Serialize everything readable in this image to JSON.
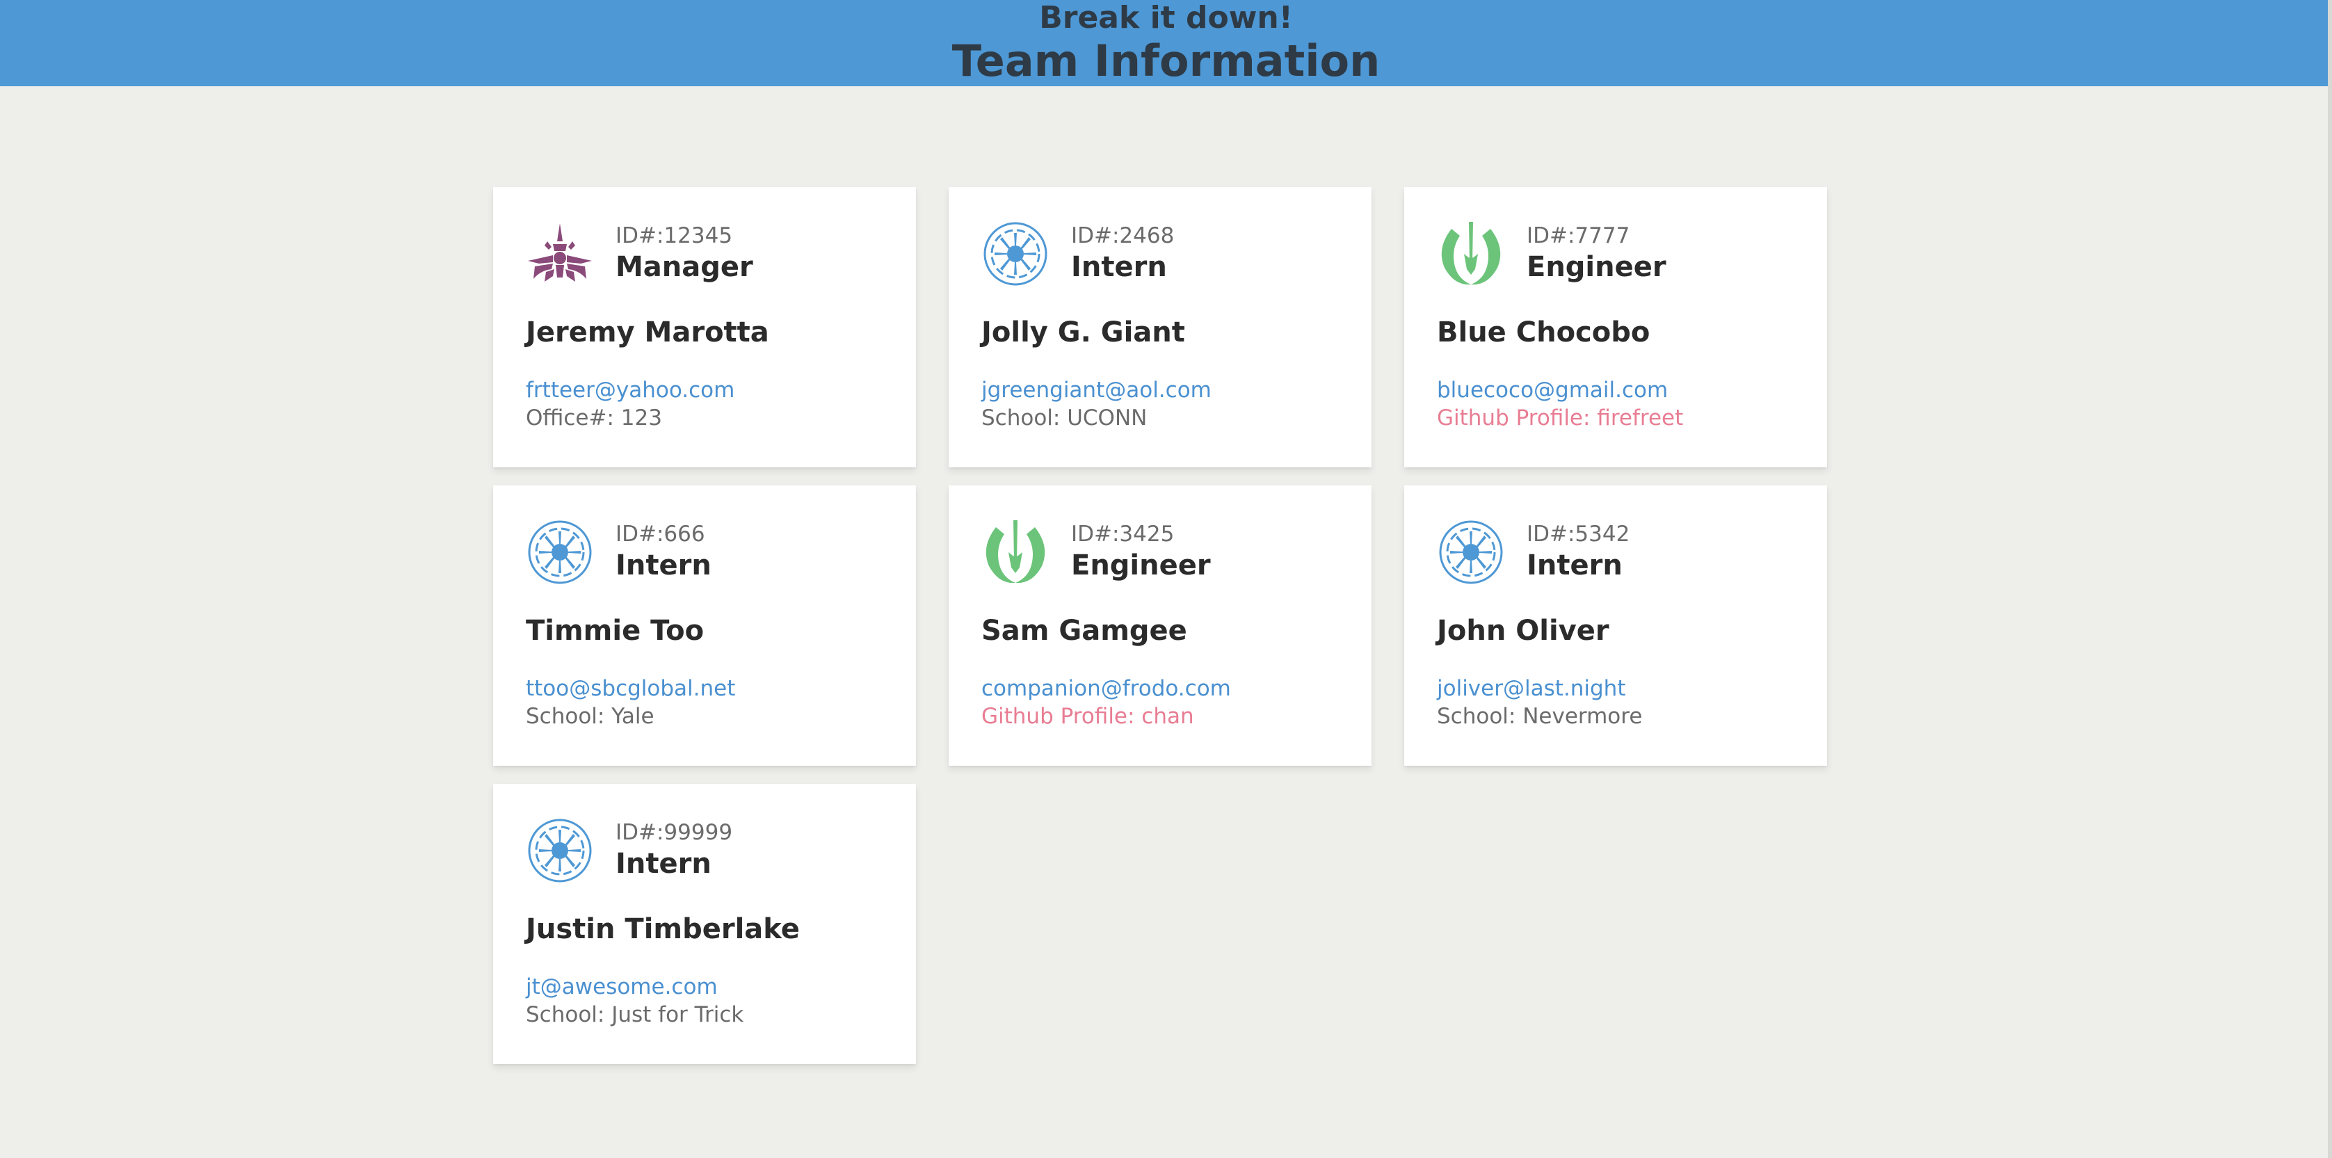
{
  "header": {
    "subtitle": "Break it down!",
    "title": "Team Information"
  },
  "colors": {
    "header_bg": "#4e98d5",
    "page_bg": "#eeeeeb",
    "link": "#4a90d0",
    "github": "#e87d93",
    "manager_icon": "#8a4a7a",
    "intern_icon": "#4e98d5",
    "engineer_icon": "#6cc47a"
  },
  "cards": [
    {
      "icon": "imperial-crest-icon",
      "id_label": "ID#:12345",
      "role": "Manager",
      "name": "Jeremy Marotta",
      "email": "frtteer@yahoo.com",
      "extra": "Office#: 123",
      "extra_kind": "office"
    },
    {
      "icon": "republic-crest-icon",
      "id_label": "ID#:2468",
      "role": "Intern",
      "name": "Jolly G. Giant",
      "email": "jgreengiant@aol.com",
      "extra": "School: UCONN",
      "extra_kind": "school"
    },
    {
      "icon": "jedi-order-icon",
      "id_label": "ID#:7777",
      "role": "Engineer",
      "name": "Blue Chocobo",
      "email": "bluecoco@gmail.com",
      "extra": "Github Profile: firefreet",
      "extra_kind": "github"
    },
    {
      "icon": "republic-crest-icon",
      "id_label": "ID#:666",
      "role": "Intern",
      "name": "Timmie Too",
      "email": "ttoo@sbcglobal.net",
      "extra": "School: Yale",
      "extra_kind": "school"
    },
    {
      "icon": "jedi-order-icon",
      "id_label": "ID#:3425",
      "role": "Engineer",
      "name": "Sam Gamgee",
      "email": "companion@frodo.com",
      "extra": "Github Profile: chan",
      "extra_kind": "github"
    },
    {
      "icon": "republic-crest-icon",
      "id_label": "ID#:5342",
      "role": "Intern",
      "name": "John Oliver",
      "email": "joliver@last.night",
      "extra": "School: Nevermore",
      "extra_kind": "school"
    },
    {
      "icon": "republic-crest-icon",
      "id_label": "ID#:99999",
      "role": "Intern",
      "name": "Justin Timberlake",
      "email": "jt@awesome.com",
      "extra": "School: Just for Trick",
      "extra_kind": "school"
    }
  ]
}
